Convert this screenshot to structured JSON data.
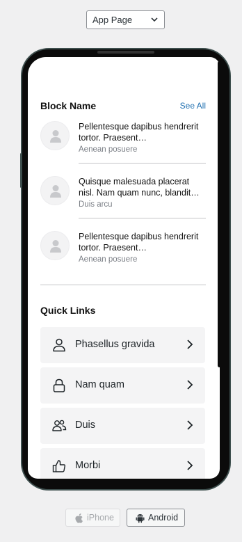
{
  "device_select": {
    "value": "App Page"
  },
  "block": {
    "title": "Block Name",
    "see_all": "See All",
    "items": [
      {
        "title": "Pellentesque dapibus hendrerit tortor. Praesent…",
        "subtitle": "Aenean posuere"
      },
      {
        "title": "Quisque malesuada placerat nisl. Nam quam nunc, blandit…",
        "subtitle": "Duis arcu"
      },
      {
        "title": "Pellentesque dapibus hendrerit tortor. Praesent…",
        "subtitle": "Aenean posuere"
      }
    ]
  },
  "quick_links": {
    "title": "Quick Links",
    "items": [
      {
        "label": "Phasellus gravida",
        "icon": "user-icon"
      },
      {
        "label": "Nam quam",
        "icon": "lock-icon"
      },
      {
        "label": "Duis",
        "icon": "users-icon"
      },
      {
        "label": "Morbi",
        "icon": "thumbs-up-icon"
      }
    ]
  },
  "platform_buttons": {
    "iphone": "iPhone",
    "android": "Android"
  },
  "colors": {
    "link": "#2271b1",
    "card_bg": "#f4f4f5",
    "phone_frame": "#3d4e4d"
  }
}
